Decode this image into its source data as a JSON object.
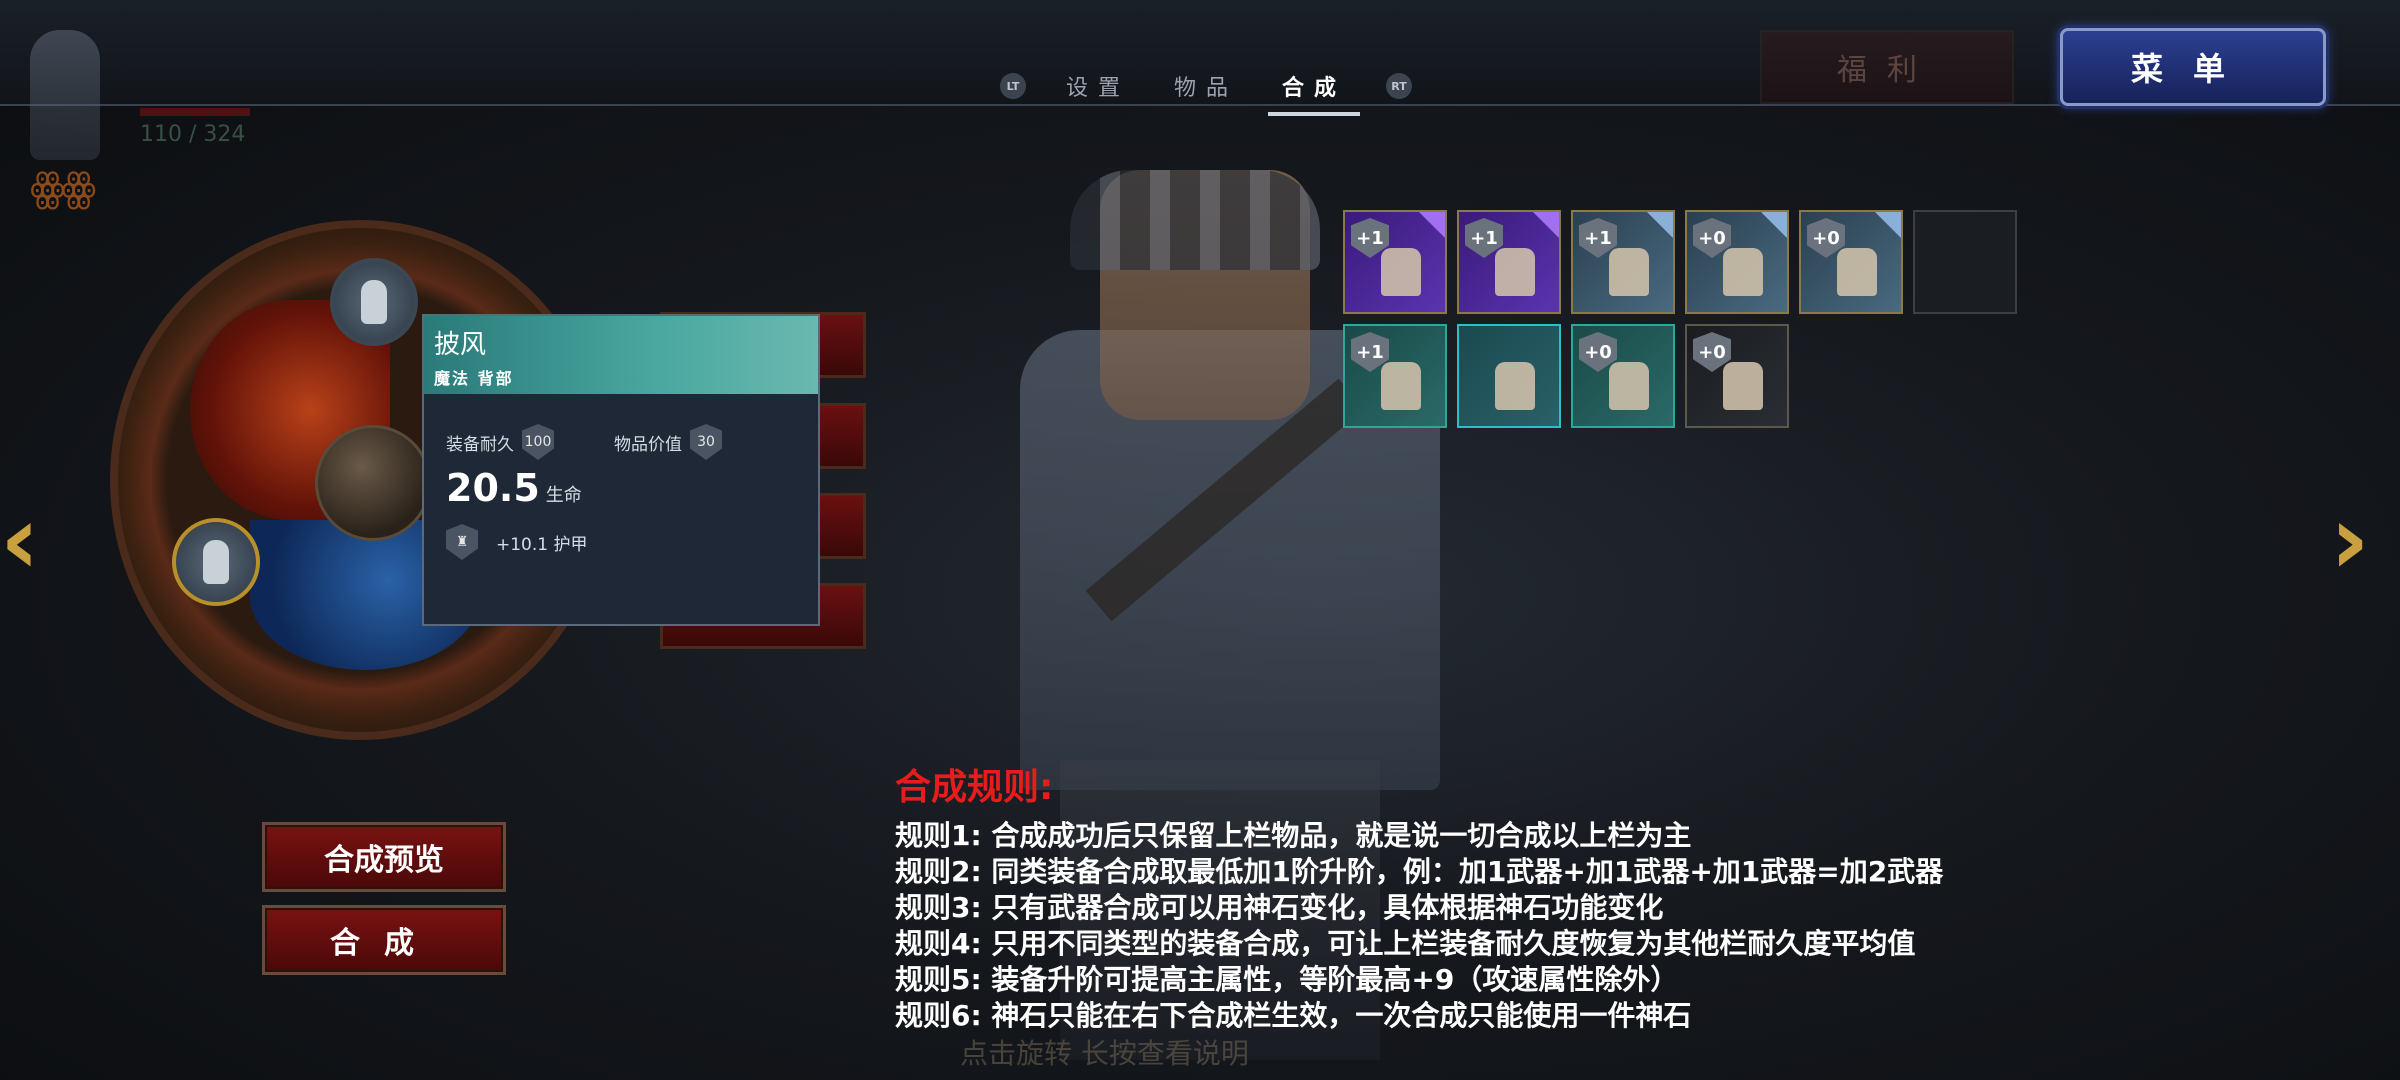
{
  "player": {
    "name": "",
    "subtitle": "",
    "hp": "110 / 324"
  },
  "tabs": {
    "left_trigger": "LT",
    "right_trigger": "RT",
    "items": [
      {
        "label": "设置"
      },
      {
        "label": "物品"
      },
      {
        "label": "合成",
        "active": true
      }
    ]
  },
  "buttons": {
    "welfare": "福利",
    "menu": "菜单",
    "preview": "合成预览",
    "craft": "合成"
  },
  "tooltip": {
    "name": "披风",
    "type": "魔法 背部",
    "durability_label": "装备耐久",
    "durability_value": "100",
    "value_label": "物品价值",
    "value_value": "30",
    "main_stat_value": "20.5",
    "main_stat_unit": "生命",
    "armor_text": "+10.1  护甲"
  },
  "inventory": [
    {
      "level": "+1",
      "rarity": "purple"
    },
    {
      "level": "+1",
      "rarity": "purple"
    },
    {
      "level": "+1",
      "rarity": "blue"
    },
    {
      "level": "+0",
      "rarity": "blue"
    },
    {
      "level": "+0",
      "rarity": "blue"
    },
    {
      "level": "",
      "rarity": "empty"
    },
    {
      "level": "+1",
      "rarity": "teal"
    },
    {
      "level": "",
      "rarity": "cyan"
    },
    {
      "level": "+0",
      "rarity": "teal"
    },
    {
      "level": "+0",
      "rarity": "dark"
    }
  ],
  "rules": {
    "title": "合成规则:",
    "items": [
      "规则1: 合成成功后只保留上栏物品，就是说一切合成以上栏为主",
      "规则2: 同类装备合成取最低加1阶升阶，例：加1武器+加1武器+加1武器=加2武器",
      "规则3: 只有武器合成可以用神石变化，具体根据神石功能变化",
      "规则4: 只用不同类型的装备合成，可让上栏装备耐久度恢复为其他栏耐久度平均值",
      "规则5: 装备升阶可提高主属性，等阶最高+9（攻速属性除外）",
      "规则6: 神石只能在右下合成栏生效，一次合成只能使用一件神石"
    ]
  },
  "hint": "点击旋转  长按查看说明"
}
